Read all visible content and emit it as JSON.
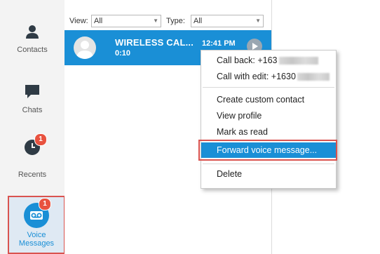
{
  "sidebar": {
    "contacts_label": "Contacts",
    "chats_label": "Chats",
    "recents_label": "Recents",
    "recents_badge": "1",
    "voice_label_line1": "Voice",
    "voice_label_line2": "Messages",
    "voice_badge": "1",
    "active_item": "voice-messages"
  },
  "filters": {
    "view_label": "View:",
    "view_value": "All",
    "type_label": "Type:",
    "type_value": "All"
  },
  "message": {
    "caller": "WIRELESS CAL...",
    "duration": "0:10",
    "time": "12:41 PM"
  },
  "context_menu": {
    "call_back": "Call back: +163",
    "call_with_edit": "Call with edit: +1630",
    "create_contact": "Create custom contact",
    "view_profile": "View profile",
    "mark_read": "Mark as read",
    "forward": "Forward voice message...",
    "delete": "Delete"
  },
  "colors": {
    "accent": "#1a8fd6",
    "badge": "#e8523f",
    "highlight_outline": "#d9534f"
  }
}
